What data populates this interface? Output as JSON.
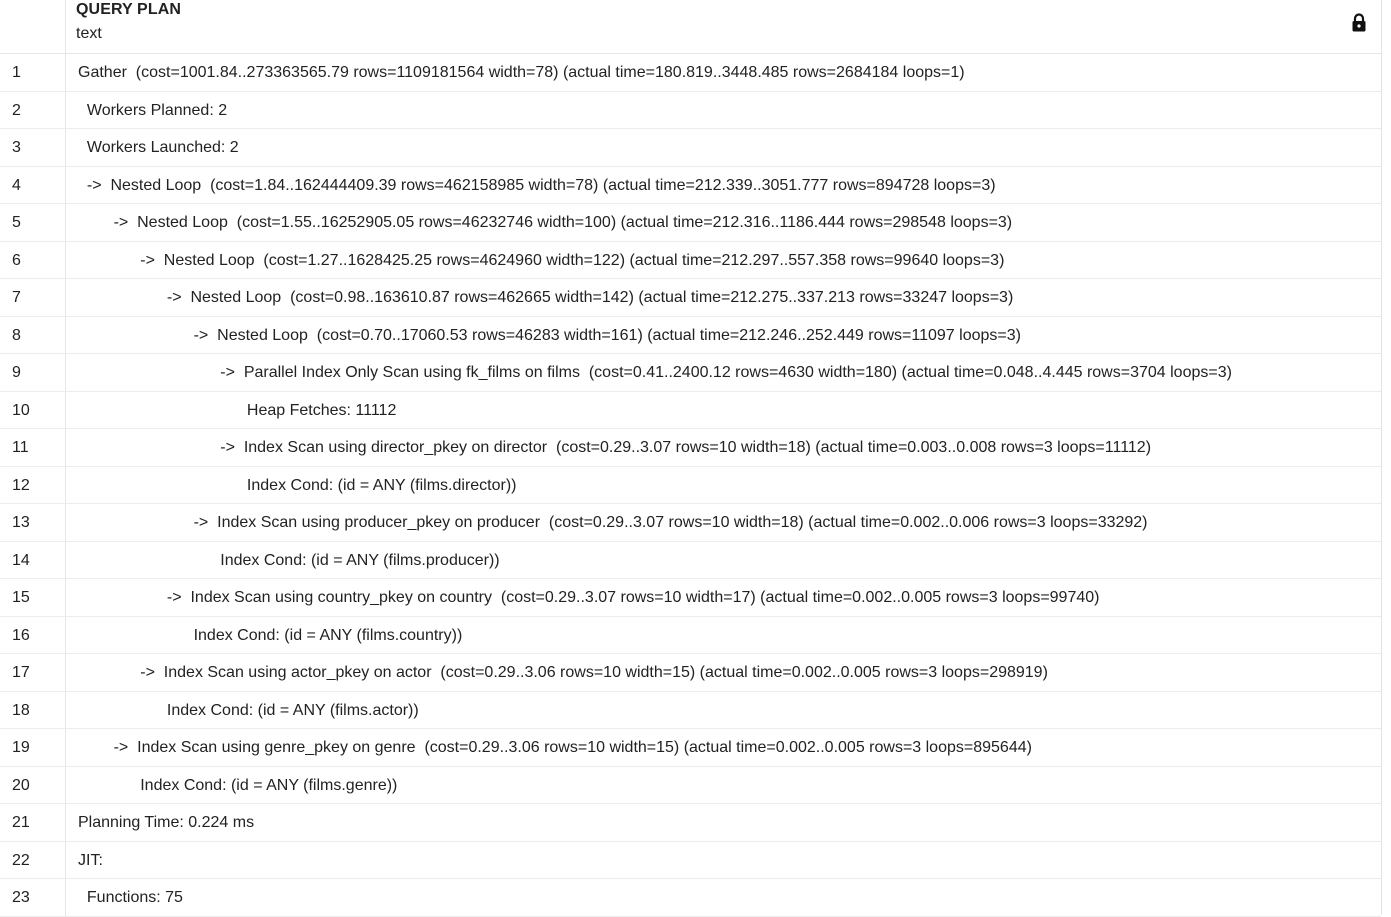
{
  "header": {
    "column_title": "QUERY PLAN",
    "column_type": "text",
    "lock_icon": "lock-icon"
  },
  "rows": [
    {
      "num": "1",
      "text": "Gather  (cost=1001.84..273363565.79 rows=1109181564 width=78) (actual time=180.819..3448.485 rows=2684184 loops=1)"
    },
    {
      "num": "2",
      "text": "  Workers Planned: 2"
    },
    {
      "num": "3",
      "text": "  Workers Launched: 2"
    },
    {
      "num": "4",
      "text": "  ->  Nested Loop  (cost=1.84..162444409.39 rows=462158985 width=78) (actual time=212.339..3051.777 rows=894728 loops=3)"
    },
    {
      "num": "5",
      "text": "        ->  Nested Loop  (cost=1.55..16252905.05 rows=46232746 width=100) (actual time=212.316..1186.444 rows=298548 loops=3)"
    },
    {
      "num": "6",
      "text": "              ->  Nested Loop  (cost=1.27..1628425.25 rows=4624960 width=122) (actual time=212.297..557.358 rows=99640 loops=3)"
    },
    {
      "num": "7",
      "text": "                    ->  Nested Loop  (cost=0.98..163610.87 rows=462665 width=142) (actual time=212.275..337.213 rows=33247 loops=3)"
    },
    {
      "num": "8",
      "text": "                          ->  Nested Loop  (cost=0.70..17060.53 rows=46283 width=161) (actual time=212.246..252.449 rows=11097 loops=3)"
    },
    {
      "num": "9",
      "text": "                                ->  Parallel Index Only Scan using fk_films on films  (cost=0.41..2400.12 rows=4630 width=180) (actual time=0.048..4.445 rows=3704 loops=3)"
    },
    {
      "num": "10",
      "text": "                                      Heap Fetches: 11112"
    },
    {
      "num": "11",
      "text": "                                ->  Index Scan using director_pkey on director  (cost=0.29..3.07 rows=10 width=18) (actual time=0.003..0.008 rows=3 loops=11112)"
    },
    {
      "num": "12",
      "text": "                                      Index Cond: (id = ANY (films.director))"
    },
    {
      "num": "13",
      "text": "                          ->  Index Scan using producer_pkey on producer  (cost=0.29..3.07 rows=10 width=18) (actual time=0.002..0.006 rows=3 loops=33292)"
    },
    {
      "num": "14",
      "text": "                                Index Cond: (id = ANY (films.producer))"
    },
    {
      "num": "15",
      "text": "                    ->  Index Scan using country_pkey on country  (cost=0.29..3.07 rows=10 width=17) (actual time=0.002..0.005 rows=3 loops=99740)"
    },
    {
      "num": "16",
      "text": "                          Index Cond: (id = ANY (films.country))"
    },
    {
      "num": "17",
      "text": "              ->  Index Scan using actor_pkey on actor  (cost=0.29..3.06 rows=10 width=15) (actual time=0.002..0.005 rows=3 loops=298919)"
    },
    {
      "num": "18",
      "text": "                    Index Cond: (id = ANY (films.actor))"
    },
    {
      "num": "19",
      "text": "        ->  Index Scan using genre_pkey on genre  (cost=0.29..3.06 rows=10 width=15) (actual time=0.002..0.005 rows=3 loops=895644)"
    },
    {
      "num": "20",
      "text": "              Index Cond: (id = ANY (films.genre))"
    },
    {
      "num": "21",
      "text": "Planning Time: 0.224 ms"
    },
    {
      "num": "22",
      "text": "JIT:"
    },
    {
      "num": "23",
      "text": "  Functions: 75"
    }
  ]
}
